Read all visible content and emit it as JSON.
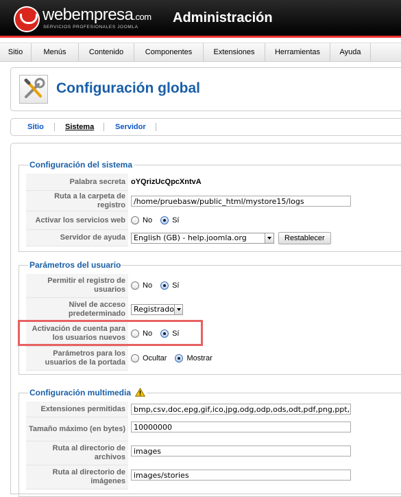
{
  "header": {
    "logo_main": "webempresa",
    "logo_tld": ".com",
    "logo_sub": "SERVICIOS PROFESIONALES JOOMLA",
    "title": "Administración"
  },
  "menu": [
    "Sitio",
    "Menús",
    "Contenido",
    "Componentes",
    "Extensiones",
    "Herramientas",
    "Ayuda"
  ],
  "page": {
    "title": "Configuración global",
    "icon": "wrench-screwdriver-icon"
  },
  "subtabs": {
    "sitio": "Sitio",
    "sistema": "Sistema",
    "servidor": "Servidor",
    "active": "Sistema"
  },
  "sistema": {
    "legend": "Configuración del sistema",
    "secret_label": "Palabra secreta",
    "secret_value": "oYQrizUcQpcXntvA",
    "logs_label": "Ruta a la carpeta de registro",
    "logs_value": "/home/pruebasw/public_html/mystore15/logs",
    "webservices_label": "Activar los servicios web",
    "help_server_label": "Servidor de ayuda",
    "help_server_value": "English (GB) - help.joomla.org",
    "reset_button": "Restablecer"
  },
  "usuario": {
    "legend": "Parámetros del usuario",
    "registration_label": "Permitir el registro de usuarios",
    "access_label": "Nivel de acceso predeterminado",
    "access_value": "Registrado",
    "activation_label": "Activación de cuenta para los usuarios nuevos",
    "frontend_label": "Parámetros para los usuarios de la portada"
  },
  "media": {
    "legend": "Configuración multimedia",
    "extensions_label": "Extensiones permitidas",
    "extensions_value": "bmp,csv,doc,epg,gif,ico,jpg,odg,odp,ods,odt,pdf,png,ppt,swf,txt,",
    "maxsize_label": "Tamaño máximo (en bytes)",
    "maxsize_value": "10000000",
    "files_dir_label": "Ruta al directorio de archivos",
    "files_dir_value": "images",
    "images_dir_label": "Ruta al directorio de imágenes",
    "images_dir_value": "images/stories"
  },
  "options": {
    "no": "No",
    "si": "Sí",
    "ocultar": "Ocultar",
    "mostrar": "Mostrar"
  },
  "radios_selected": {
    "webservices": "Sí",
    "registration": "Sí",
    "activation": "Sí",
    "frontend": "Mostrar"
  },
  "colors": {
    "accent": "#1a5fa8",
    "header_bg": "#000000",
    "header_rule": "#ee3333",
    "highlight": "#e86060"
  }
}
